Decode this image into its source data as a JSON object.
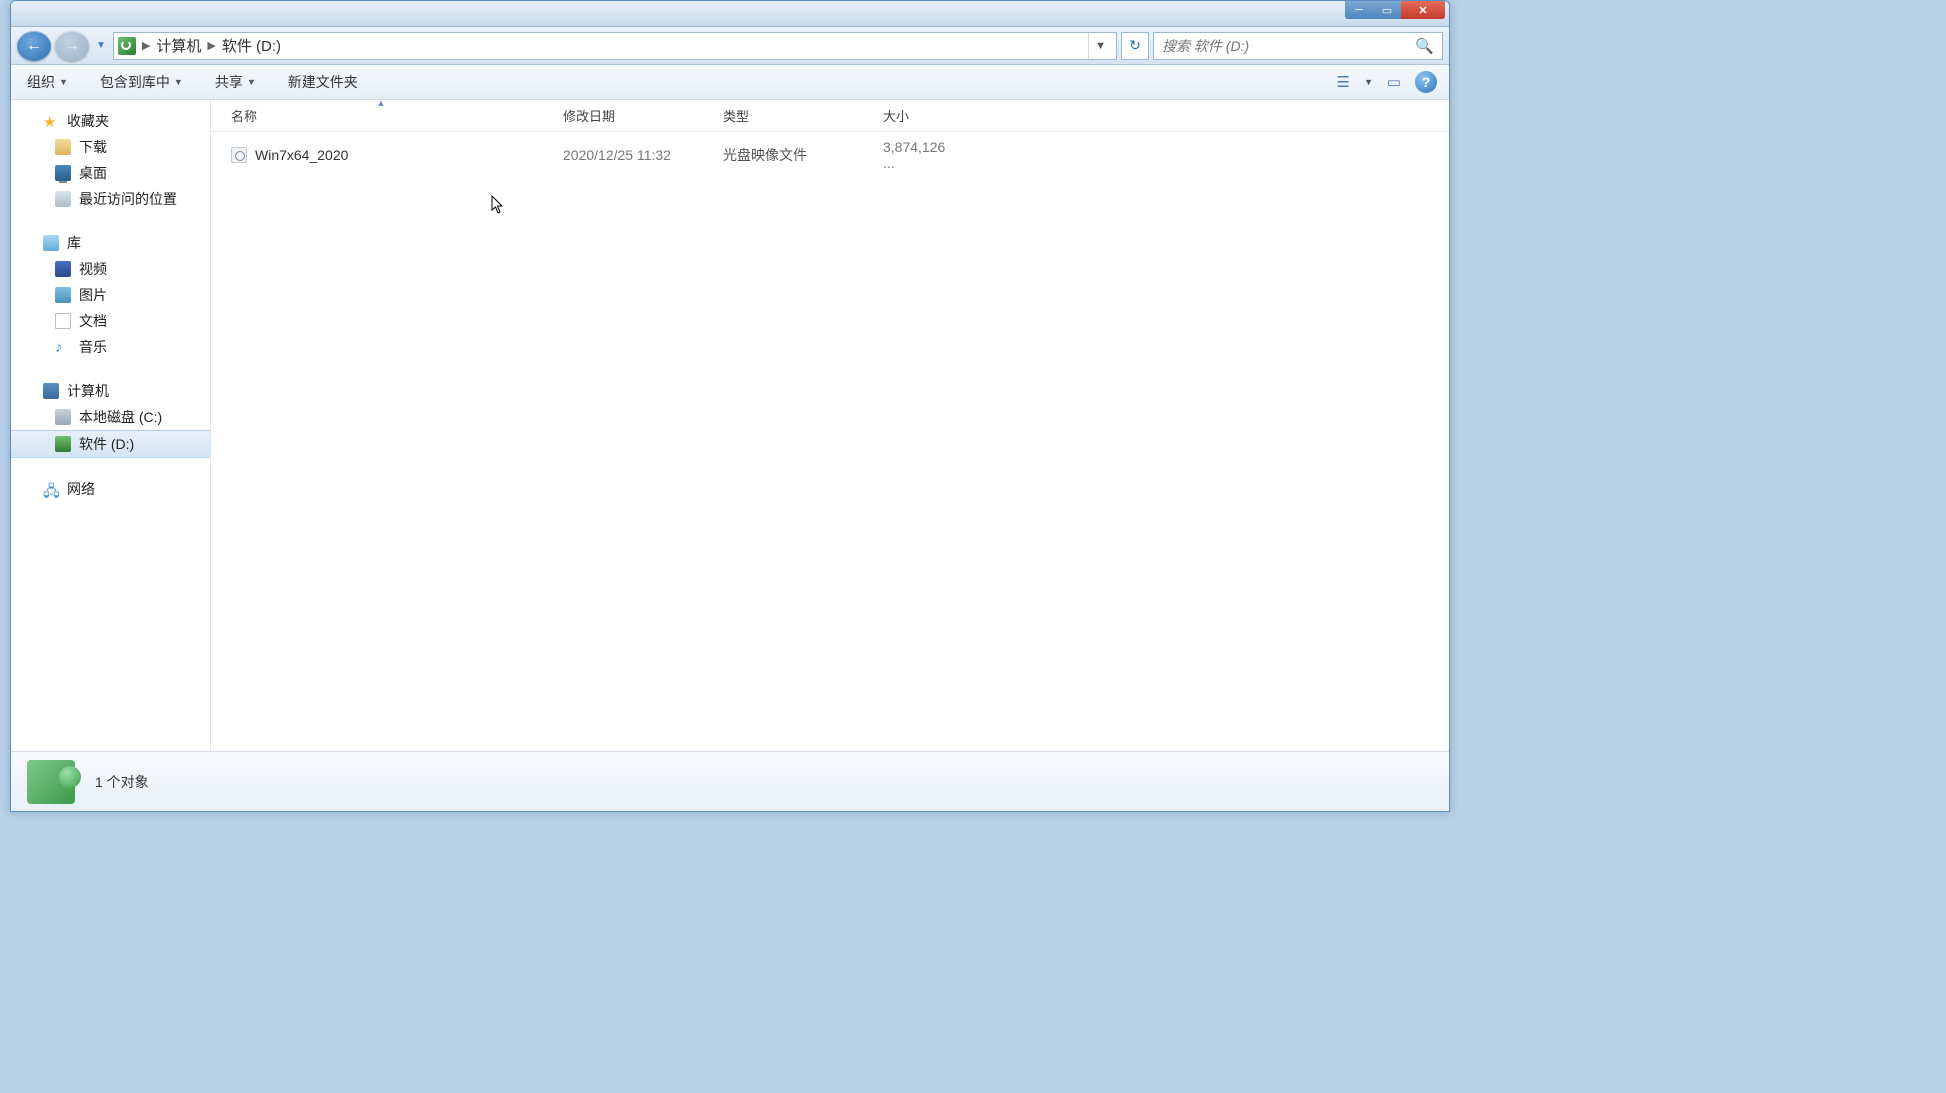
{
  "breadcrumb": {
    "item1": "计算机",
    "item2": "软件 (D:)"
  },
  "search": {
    "placeholder": "搜索 软件 (D:)"
  },
  "toolbar": {
    "organize": "组织",
    "include_lib": "包含到库中",
    "share": "共享",
    "new_folder": "新建文件夹"
  },
  "columns": {
    "name": "名称",
    "date": "修改日期",
    "type": "类型",
    "size": "大小"
  },
  "sidebar": {
    "favorites": "收藏夹",
    "downloads": "下载",
    "desktop": "桌面",
    "recent": "最近访问的位置",
    "libraries": "库",
    "videos": "视频",
    "pictures": "图片",
    "documents": "文档",
    "music": "音乐",
    "computer": "计算机",
    "local_c": "本地磁盘 (C:)",
    "software_d": "软件 (D:)",
    "network": "网络"
  },
  "file": {
    "name": "Win7x64_2020",
    "date": "2020/12/25 11:32",
    "type": "光盘映像文件",
    "size": "3,874,126 ..."
  },
  "status": {
    "text": "1 个对象"
  }
}
